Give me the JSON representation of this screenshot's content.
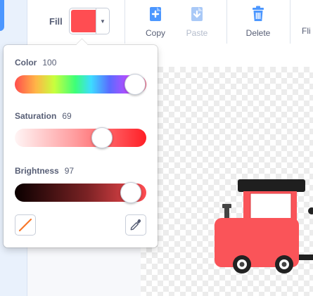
{
  "toolbar": {
    "fill_label": "Fill",
    "fill_color": "#ff4d52",
    "buttons": {
      "copy": "Copy",
      "paste": "Paste",
      "delete": "Delete",
      "flip": "Fli"
    }
  },
  "color_picker": {
    "color": {
      "label": "Color",
      "value": "100"
    },
    "saturation": {
      "label": "Saturation",
      "value": "69"
    },
    "brightness": {
      "label": "Brightness",
      "value": "97"
    }
  },
  "colors": {
    "accent": "#4c97ff",
    "text": "#575e75",
    "train_body": "#fa5459",
    "train_roof": "#222222",
    "delete_icon": "#4c97ff"
  },
  "icons": [
    "copy-icon",
    "paste-icon",
    "delete-icon",
    "no-fill-icon",
    "eyedropper-icon"
  ]
}
